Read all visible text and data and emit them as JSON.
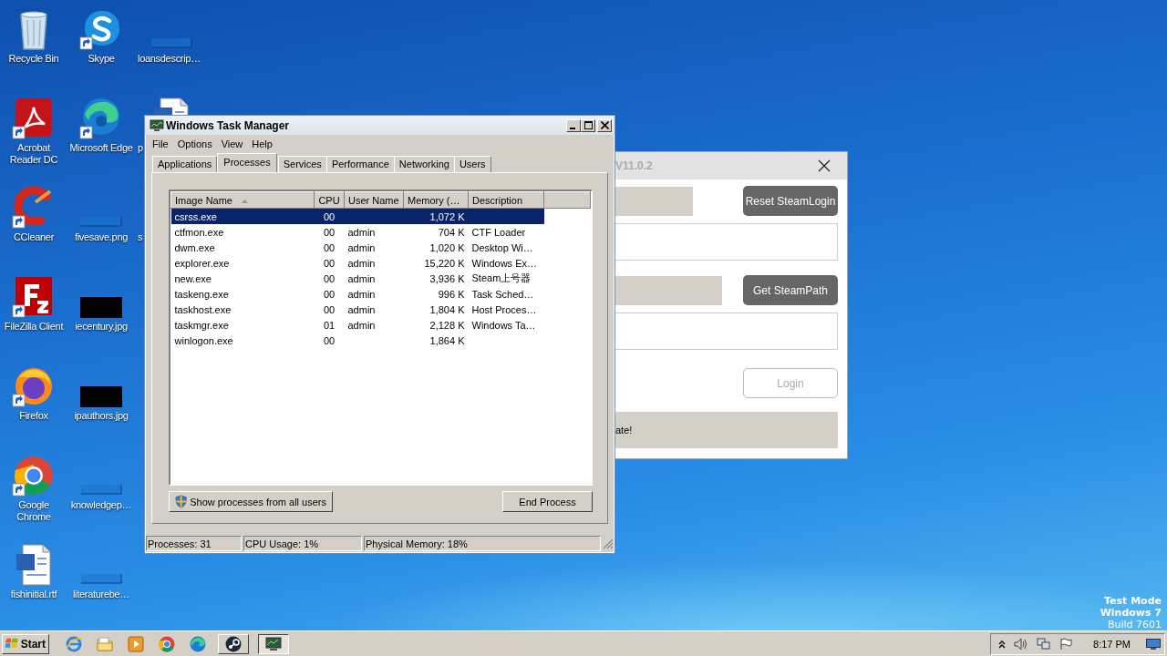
{
  "desktop": {
    "columns": [
      [
        {
          "label": "Recycle Bin",
          "kind": "recycle-bin",
          "shortcut": false
        },
        {
          "label": "Acrobat Reader DC",
          "kind": "acrobat",
          "shortcut": true
        },
        {
          "label": "CCleaner",
          "kind": "ccleaner",
          "shortcut": true
        },
        {
          "label": "FileZilla Client",
          "kind": "filezilla",
          "shortcut": true
        },
        {
          "label": "Firefox",
          "kind": "firefox",
          "shortcut": true
        },
        {
          "label": "Google Chrome",
          "kind": "chrome",
          "shortcut": true
        },
        {
          "label": "fishinitial.rtf",
          "kind": "word",
          "shortcut": false
        }
      ],
      [
        {
          "label": "Skype",
          "kind": "skype",
          "shortcut": true
        },
        {
          "label": "Microsoft Edge",
          "kind": "edge",
          "shortcut": true
        },
        {
          "label": "fivesave.png",
          "kind": "blank",
          "shortcut": false
        },
        {
          "label": "iecentury.jpg",
          "kind": "black",
          "shortcut": false
        },
        {
          "label": "ipauthors.jpg",
          "kind": "black",
          "shortcut": false
        },
        {
          "label": "knowledgep…",
          "kind": "blank",
          "shortcut": false
        },
        {
          "label": "literaturebe…",
          "kind": "blank",
          "shortcut": false
        }
      ],
      [
        {
          "label": "loansdescrip…",
          "kind": "blank",
          "shortcut": false
        },
        {
          "label": "p",
          "kind": "word"
        },
        {
          "label": "s",
          "kind": "none"
        }
      ]
    ],
    "system_text": [
      "Test Mode",
      "Windows 7",
      "Build 7601"
    ]
  },
  "steam_window": {
    "title": "V11.0.2",
    "buttons": [
      {
        "label": "Reset SteamLogin",
        "kind": "filled"
      },
      {
        "label": "Get SteamPath",
        "kind": "filled"
      },
      {
        "label": "Login",
        "kind": "outline"
      }
    ],
    "status": "ate!"
  },
  "task_manager": {
    "title": "Windows Task Manager",
    "menu": [
      "File",
      "Options",
      "View",
      "Help"
    ],
    "tabs": [
      {
        "label": "Applications",
        "selected": false
      },
      {
        "label": "Processes",
        "selected": true
      },
      {
        "label": "Services",
        "selected": false
      },
      {
        "label": "Performance",
        "selected": false
      },
      {
        "label": "Networking",
        "selected": false
      },
      {
        "label": "Users",
        "selected": false
      }
    ],
    "columns": [
      {
        "label": "Image Name",
        "sorted": true
      },
      {
        "label": "CPU",
        "sorted": false
      },
      {
        "label": "User Name",
        "sorted": false
      },
      {
        "label": "Memory (…",
        "sorted": false
      },
      {
        "label": "Description",
        "sorted": false
      }
    ],
    "rows": [
      {
        "image": "csrss.exe",
        "cpu": "00",
        "user": "",
        "memory": "1,072 K",
        "description": "",
        "selected": true
      },
      {
        "image": "ctfmon.exe",
        "cpu": "00",
        "user": "admin",
        "memory": "704 K",
        "description": "CTF Loader",
        "selected": false
      },
      {
        "image": "dwm.exe",
        "cpu": "00",
        "user": "admin",
        "memory": "1,020 K",
        "description": "Desktop Wi…",
        "selected": false
      },
      {
        "image": "explorer.exe",
        "cpu": "00",
        "user": "admin",
        "memory": "15,220 K",
        "description": "Windows Ex…",
        "selected": false
      },
      {
        "image": "new.exe",
        "cpu": "00",
        "user": "admin",
        "memory": "3,936 K",
        "description": "Steam上号器",
        "selected": false
      },
      {
        "image": "taskeng.exe",
        "cpu": "00",
        "user": "admin",
        "memory": "996 K",
        "description": "Task Sched…",
        "selected": false
      },
      {
        "image": "taskhost.exe",
        "cpu": "00",
        "user": "admin",
        "memory": "1,804 K",
        "description": "Host Proces…",
        "selected": false
      },
      {
        "image": "taskmgr.exe",
        "cpu": "01",
        "user": "admin",
        "memory": "2,128 K",
        "description": "Windows Ta…",
        "selected": false
      },
      {
        "image": "winlogon.exe",
        "cpu": "00",
        "user": "",
        "memory": "1,864 K",
        "description": "",
        "selected": false
      }
    ],
    "show_all_button": "Show processes from all users",
    "end_button": "End Process",
    "status_bar": [
      "Processes: 31",
      "CPU Usage: 1%",
      "Physical Memory: 18%"
    ]
  },
  "taskbar": {
    "start": "Start",
    "apps": [
      {
        "kind": "ie",
        "open": false,
        "selected": false
      },
      {
        "kind": "folder",
        "open": false,
        "selected": false
      },
      {
        "kind": "media",
        "open": false,
        "selected": false
      },
      {
        "kind": "chrome",
        "open": false,
        "selected": false
      },
      {
        "kind": "edge",
        "open": false,
        "selected": false
      },
      {
        "kind": "steam",
        "open": true,
        "selected": false
      },
      {
        "kind": "taskmgr",
        "open": true,
        "selected": true
      }
    ],
    "clock": "8:17 PM"
  }
}
